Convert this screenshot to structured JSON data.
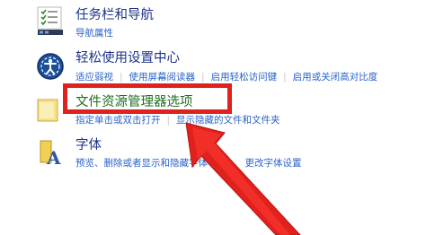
{
  "items": {
    "taskbar": {
      "title": "任务栏和导航",
      "links": [
        "导航属性"
      ]
    },
    "ease": {
      "title": "轻松使用设置中心",
      "links": [
        "适应弱视",
        "使用屏幕阅读器",
        "启用轻松访问键",
        "启用或关闭高对比度"
      ]
    },
    "explorer": {
      "title": "文件资源管理器选项",
      "links": [
        "指定单击或双击打开",
        "显示隐藏的文件和文件夹"
      ]
    },
    "fonts": {
      "title": "字体",
      "links": [
        "预览、删除或者显示和隐藏字体",
        "更改字体设置"
      ]
    }
  },
  "icons": {
    "taskbar": "taskbar-icon",
    "ease": "ease-of-access-icon",
    "explorer": "folder-options-icon",
    "fonts": "fonts-icon"
  },
  "colors": {
    "title": "#1e3287",
    "highlight_title": "#1f6f1f",
    "link": "#2a63c8",
    "annotation": "#e0211d"
  }
}
